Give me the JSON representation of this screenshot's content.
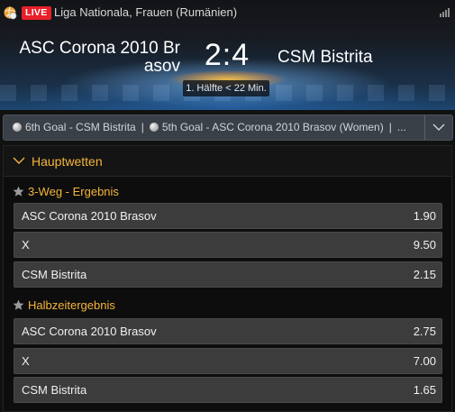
{
  "header": {
    "live_label": "LIVE",
    "league": "Liga Nationala, Frauen (Rumänien)",
    "home_team": "ASC Corona 2010 Brasov",
    "away_team": "CSM Bistrita",
    "score": "2:4",
    "period": "1. Hälfte < 22 Min."
  },
  "ticker": {
    "items": [
      "6th Goal - CSM Bistrita",
      "5th Goal - ASC Corona 2010 Brasov (Women)"
    ],
    "more": "..."
  },
  "panel": {
    "title": "Hauptwetten",
    "markets": [
      {
        "name": "3-Weg - Ergebnis",
        "outcomes": [
          {
            "label": "ASC Corona 2010 Brasov",
            "odds": "1.90"
          },
          {
            "label": "X",
            "odds": "9.50"
          },
          {
            "label": "CSM Bistrita",
            "odds": "2.15"
          }
        ]
      },
      {
        "name": "Halbzeitergebnis",
        "outcomes": [
          {
            "label": "ASC Corona 2010 Brasov",
            "odds": "2.75"
          },
          {
            "label": "X",
            "odds": "7.00"
          },
          {
            "label": "CSM Bistrita",
            "odds": "1.65"
          }
        ]
      }
    ]
  },
  "colors": {
    "accent": "#f5b53a",
    "live": "#e8202a",
    "odds_row": "#3c3c3c"
  }
}
